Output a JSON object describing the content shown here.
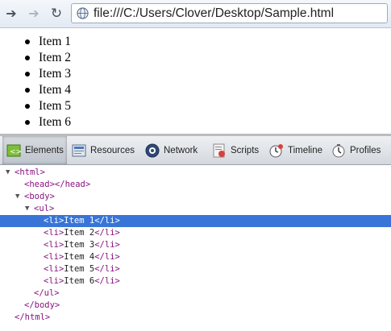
{
  "browser": {
    "url": "file:///C:/Users/Clover/Desktop/Sample.html",
    "icons": {
      "back": "back-arrow-icon",
      "forward": "forward-arrow-icon",
      "reload": "reload-icon",
      "page": "globe-icon"
    }
  },
  "page": {
    "items": [
      "Item 1",
      "Item 2",
      "Item 3",
      "Item 4",
      "Item 5",
      "Item 6"
    ]
  },
  "devtools": {
    "tabs": [
      {
        "label": "Elements",
        "icon": "elements-icon",
        "selected": true
      },
      {
        "label": "Resources",
        "icon": "resources-icon"
      },
      {
        "label": "Network",
        "icon": "network-icon"
      },
      {
        "label": "Scripts",
        "icon": "scripts-icon"
      },
      {
        "label": "Timeline",
        "icon": "timeline-icon"
      },
      {
        "label": "Profiles",
        "icon": "profiles-icon"
      }
    ],
    "dom_lines": [
      "<html>",
      "<head></head>",
      "<body>",
      "<ul>",
      "<li>Item 1</li>",
      "<li>Item 2</li>",
      "<li>Item 3</li>",
      "<li>Item 4</li>",
      "<li>Item 5</li>",
      "<li>Item 6</li>",
      "</ul>",
      "</body>",
      "</html>"
    ],
    "colors": {
      "selection": "#3875d7",
      "tag": "#881280"
    }
  }
}
